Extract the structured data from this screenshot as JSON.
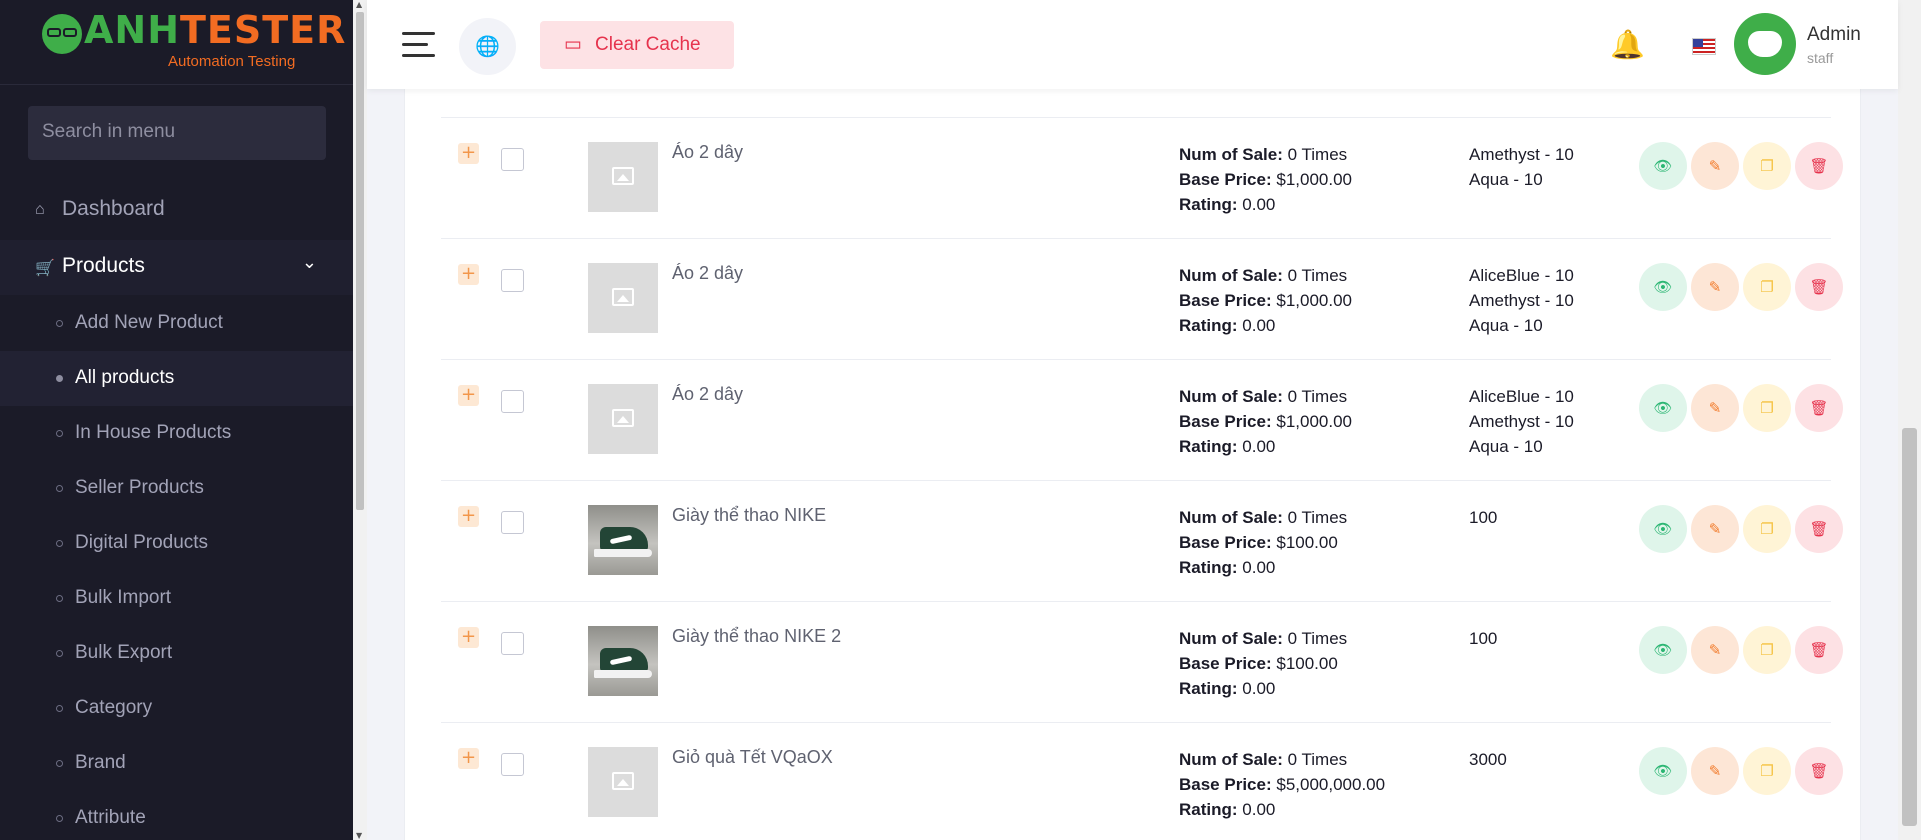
{
  "brand": {
    "logo_text": "ANHTESTER",
    "logo_sub": "Automation Testing"
  },
  "sidebar": {
    "search_placeholder": "Search in menu",
    "dashboard": "Dashboard",
    "products": "Products",
    "sub_items": [
      "Add New Product",
      "All products",
      "In House Products",
      "Seller Products",
      "Digital Products",
      "Bulk Import",
      "Bulk Export",
      "Category",
      "Brand",
      "Attribute"
    ]
  },
  "topbar": {
    "clear_cache": "Clear Cache",
    "admin_name": "Admin",
    "admin_role": "staff"
  },
  "labels": {
    "num_of_sale": "Num of Sale:",
    "base_price": "Base Price:",
    "rating": "Rating:"
  },
  "products": [
    {
      "name": "Áo 2 dây",
      "sales": "0 Times",
      "price": "$1,000.00",
      "rating": "0.00",
      "stock": [
        "Amethyst - 10",
        "Aqua - 10"
      ],
      "image": "placeholder"
    },
    {
      "name": "Áo 2 dây",
      "sales": "0 Times",
      "price": "$1,000.00",
      "rating": "0.00",
      "stock": [
        "AliceBlue - 10",
        "Amethyst - 10",
        "Aqua - 10"
      ],
      "image": "placeholder"
    },
    {
      "name": "Áo 2 dây",
      "sales": "0 Times",
      "price": "$1,000.00",
      "rating": "0.00",
      "stock": [
        "AliceBlue - 10",
        "Amethyst - 10",
        "Aqua - 10"
      ],
      "image": "placeholder"
    },
    {
      "name": "Giày thể thao NIKE",
      "sales": "0 Times",
      "price": "$100.00",
      "rating": "0.00",
      "stock": [
        "100"
      ],
      "image": "shoe"
    },
    {
      "name": "Giày thể thao NIKE 2",
      "sales": "0 Times",
      "price": "$100.00",
      "rating": "0.00",
      "stock": [
        "100"
      ],
      "image": "shoe"
    },
    {
      "name": "Giỏ quà Tết VQaOX",
      "sales": "0 Times",
      "price": "$5,000,000.00",
      "rating": "0.00",
      "stock": [
        "3000"
      ],
      "image": "placeholder"
    }
  ],
  "colors": {
    "sidebar_bg": "#1b1b28",
    "accent_green": "#3fae49",
    "accent_orange": "#f26c22",
    "danger": "#e6334d"
  }
}
